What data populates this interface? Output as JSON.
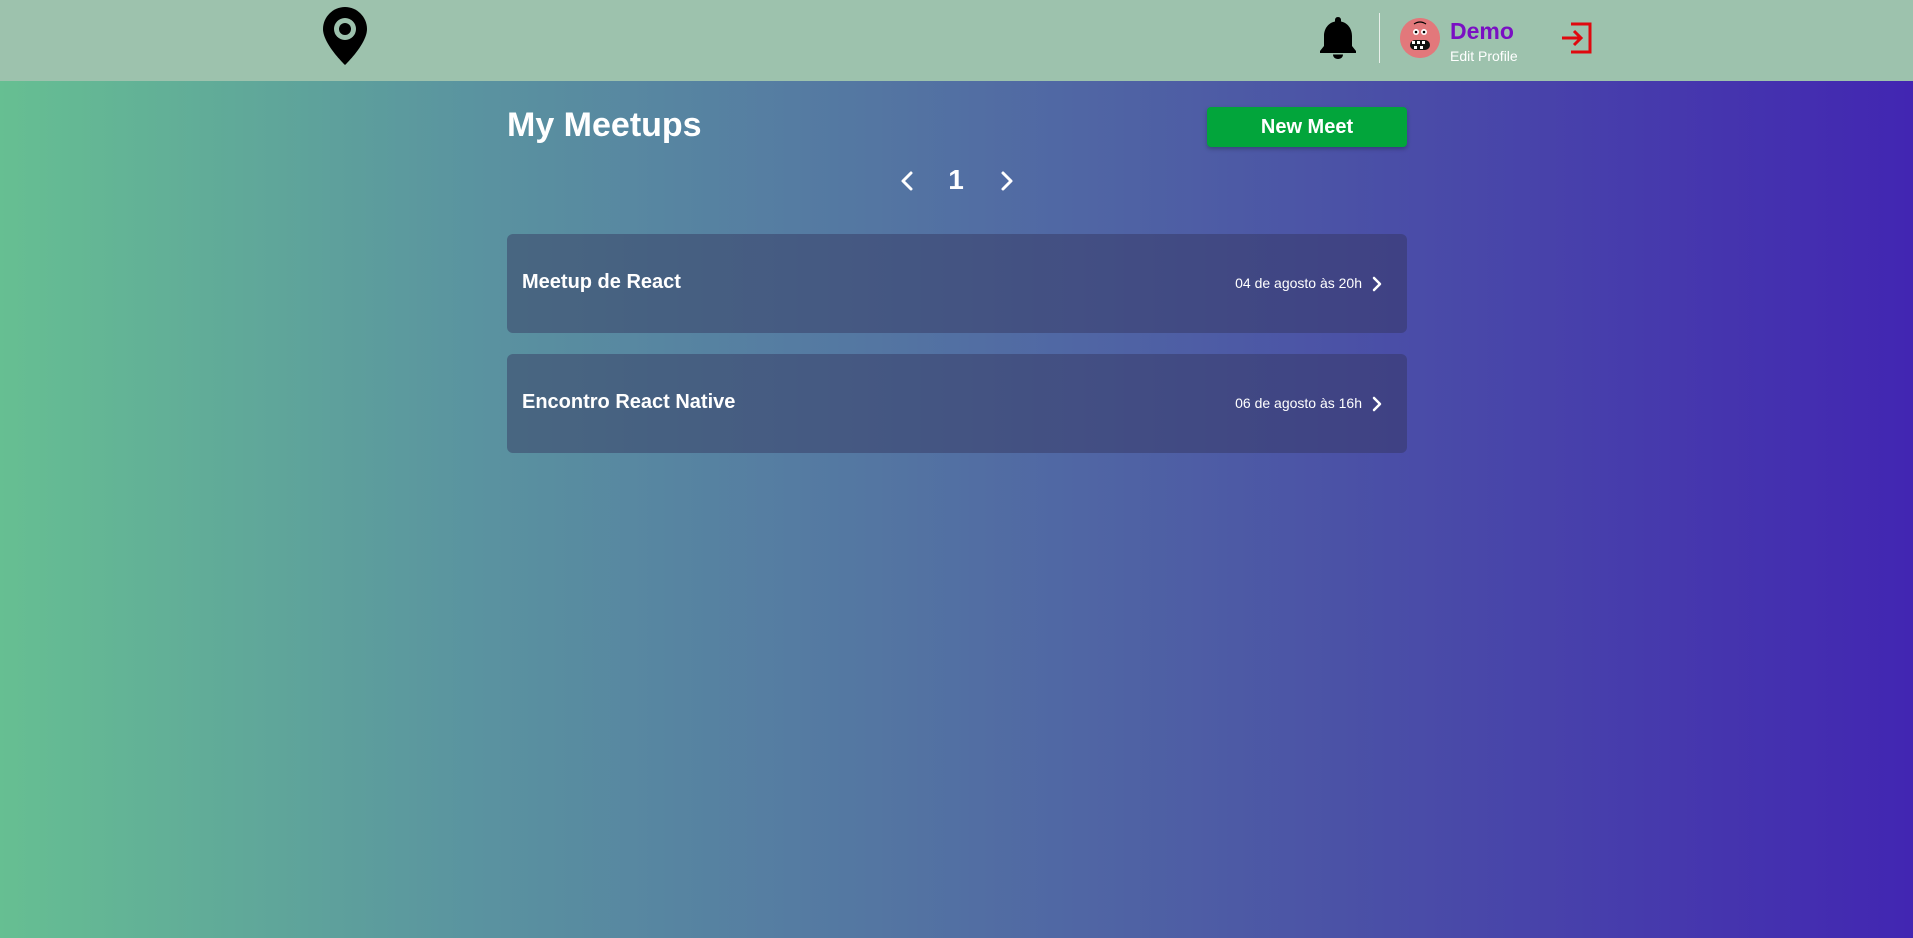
{
  "header": {
    "logo_icon": "map-pin-icon",
    "notifications_icon": "bell-icon",
    "user": {
      "name": "Demo",
      "edit_profile_label": "Edit Profile",
      "avatar_icon": "avatar-face"
    },
    "logout_icon": "logout-icon"
  },
  "main": {
    "title": "My Meetups",
    "new_meet_label": "New Meet",
    "pagination": {
      "current_page": "1",
      "prev_icon": "chevron-left-icon",
      "next_icon": "chevron-right-icon"
    },
    "meetups": [
      {
        "title": "Meetup de React",
        "date": "04 de agosto às 20h"
      },
      {
        "title": "Encontro React Native",
        "date": "06 de agosto às 16h"
      }
    ]
  },
  "colors": {
    "header_bg": "#9dc2ad",
    "username": "#7a0fc3",
    "logout": "#e0080e",
    "new_meet_button": "#02a53b",
    "gradient_start": "#66bf92",
    "gradient_end": "#4226b2"
  }
}
